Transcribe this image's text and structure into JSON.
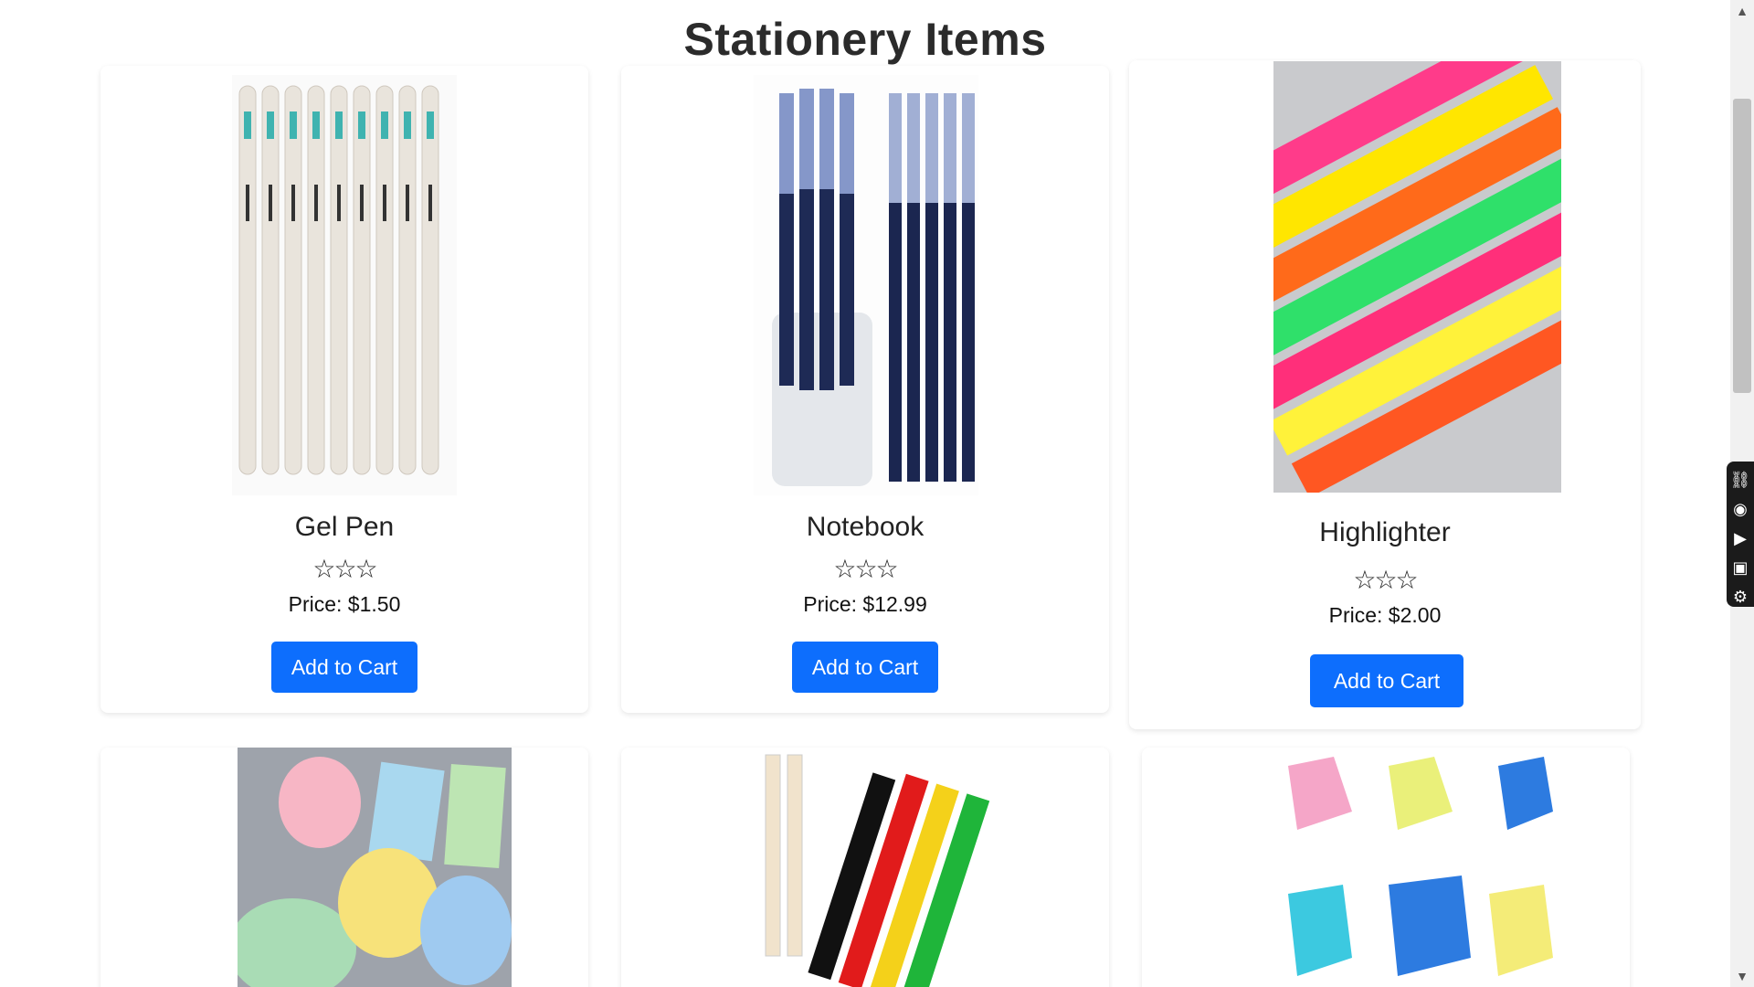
{
  "page": {
    "title": "Stationery Items"
  },
  "products": [
    {
      "name": "Gel Pen",
      "rating_stars": "☆☆☆",
      "price": "Price: $1.50",
      "button": "Add to Cart"
    },
    {
      "name": "Notebook",
      "rating_stars": "☆☆☆",
      "price": "Price: $12.99",
      "button": "Add to Cart"
    },
    {
      "name": "Highlighter",
      "rating_stars": "☆☆☆",
      "price": "Price: $2.00",
      "button": "Add to Cart"
    }
  ],
  "widget": {
    "icons": [
      "link-icon",
      "camera-icon",
      "video-icon",
      "window-icon",
      "gear-icon"
    ]
  }
}
